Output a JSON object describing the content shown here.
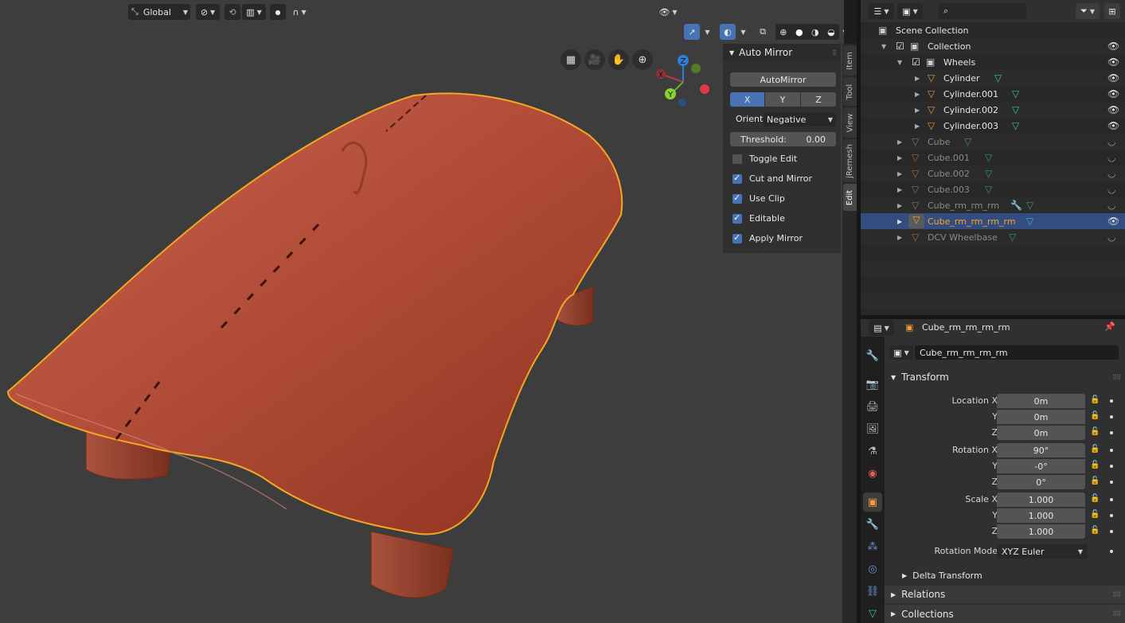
{
  "viewport": {
    "header": {
      "orientation": "Global",
      "icons": [
        "transform-orientation-icon",
        "snap-icon",
        "proportional-icon",
        "falloff-icon"
      ]
    },
    "nav_gizmo": {
      "x": "X",
      "y": "Y",
      "z": "Z"
    }
  },
  "n_panel": {
    "title": "Auto Mirror",
    "automirror_button": "AutoMirror",
    "axes": [
      "X",
      "Y",
      "Z"
    ],
    "selected_axis": "X",
    "orient_label": "Orient",
    "orient_value": "Negative",
    "threshold_label": "Threshold:",
    "threshold_value": "0.00",
    "options": [
      {
        "label": "Toggle Edit",
        "checked": false
      },
      {
        "label": "Cut and Mirror",
        "checked": true
      },
      {
        "label": "Use Clip",
        "checked": true
      },
      {
        "label": "Editable",
        "checked": true
      },
      {
        "label": "Apply Mirror",
        "checked": true
      }
    ]
  },
  "n_tabs": [
    "Item",
    "Tool",
    "View",
    "jRemesh",
    "Edit"
  ],
  "outliner": {
    "search_placeholder": "",
    "rows": [
      {
        "name": "Scene Collection"
      },
      {
        "name": "Collection"
      },
      {
        "name": "Wheels"
      },
      {
        "name": "Cylinder"
      },
      {
        "name": "Cylinder.001"
      },
      {
        "name": "Cylinder.002"
      },
      {
        "name": "Cylinder.003"
      },
      {
        "name": "Cube"
      },
      {
        "name": "Cube.001"
      },
      {
        "name": "Cube.002"
      },
      {
        "name": "Cube.003"
      },
      {
        "name": "Cube_rm_rm_rm"
      },
      {
        "name": "Cube_rm_rm_rm_rm"
      },
      {
        "name": "DCV Wheelbase"
      }
    ]
  },
  "properties": {
    "object_name_header": "Cube_rm_rm_rm_rm",
    "object_name_field": "Cube_rm_rm_rm_rm",
    "transform_title": "Transform",
    "location_label": "Location X",
    "rotation_label": "Rotation X",
    "scale_label": "Scale X",
    "y_label": "Y",
    "z_label": "Z",
    "location": [
      "0m",
      "0m",
      "0m"
    ],
    "rotation": [
      "90°",
      "-0°",
      "0°"
    ],
    "scale": [
      "1.000",
      "1.000",
      "1.000"
    ],
    "rotation_mode_label": "Rotation Mode",
    "rotation_mode_value": "XYZ Euler",
    "delta_transform": "Delta Transform",
    "relations": "Relations",
    "collections": "Collections"
  },
  "colors": {
    "accent": "#4772b3",
    "selection_outline": "#f5a623",
    "mesh_color": "#b04a33",
    "mesh_data_icon": "#2ec4a3",
    "object_icon": "#e8913c"
  }
}
